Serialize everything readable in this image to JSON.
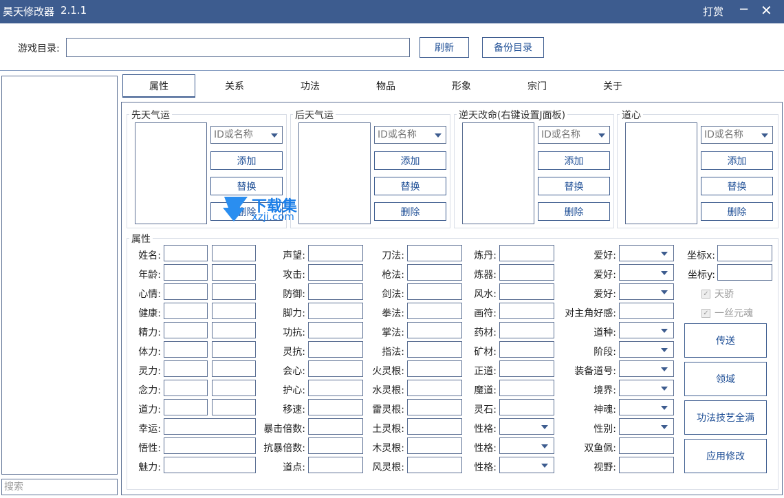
{
  "window": {
    "title": "昊天修改器",
    "version": "2.1.1",
    "tip": "打赏",
    "minimize": "−",
    "close": "✕"
  },
  "top": {
    "dir_label": "游戏目录:",
    "refresh": "刷新",
    "backup": "备份目录"
  },
  "sidebar": {
    "search_placeholder": "搜索"
  },
  "tabs": [
    "属性",
    "关系",
    "功法",
    "物品",
    "形象",
    "宗门",
    "关于"
  ],
  "groups": [
    {
      "title": "先天气运",
      "combo": "ID或名称",
      "add": "添加",
      "replace": "替换",
      "delete": "删除"
    },
    {
      "title": "后天气运",
      "combo": "ID或名称",
      "add": "添加",
      "replace": "替换",
      "delete": "删除"
    },
    {
      "title": "逆天改命(右键设置J面板)",
      "combo": "ID或名称",
      "add": "添加",
      "replace": "替换",
      "delete": "删除"
    },
    {
      "title": "道心",
      "combo": "ID或名称",
      "add": "添加",
      "replace": "替换",
      "delete": "删除"
    }
  ],
  "attr": {
    "title": "属性",
    "col1": [
      "姓名:",
      "年龄:",
      "心情:",
      "健康:",
      "精力:",
      "体力:",
      "灵力:",
      "念力:",
      "道力:",
      "幸运:",
      "悟性:",
      "魅力:"
    ],
    "col2": [
      "声望:",
      "攻击:",
      "防御:",
      "脚力:",
      "功抗:",
      "灵抗:",
      "会心:",
      "护心:",
      "移速:",
      "暴击倍数:",
      "抗暴倍数:",
      "道点:"
    ],
    "col3": [
      "刀法:",
      "枪法:",
      "剑法:",
      "拳法:",
      "掌法:",
      "指法:",
      "火灵根:",
      "水灵根:",
      "雷灵根:",
      "土灵根:",
      "木灵根:",
      "风灵根:"
    ],
    "col4": [
      "炼丹:",
      "炼器:",
      "风水:",
      "画符:",
      "药材:",
      "矿材:",
      "正道:",
      "魔道:",
      "灵石:",
      "性格:",
      "性格:",
      "性格:"
    ],
    "col5": [
      "爱好:",
      "爱好:",
      "爱好:",
      "对主角好感:",
      "道种:",
      "阶段:",
      "装备道号:",
      "境界:",
      "神魂:",
      "性别:",
      "双鱼佩:",
      "视野:"
    ],
    "coord_x": "坐标x:",
    "coord_y": "坐标y:",
    "chk_arrogant": "天骄",
    "chk_soul": "一丝元魂",
    "btn_teleport": "传送",
    "btn_domain": "领域",
    "btn_maxskills": "功法技艺全满",
    "btn_apply": "应用修改"
  },
  "watermark": {
    "text": "下载集",
    "sub": "xzji.com"
  }
}
